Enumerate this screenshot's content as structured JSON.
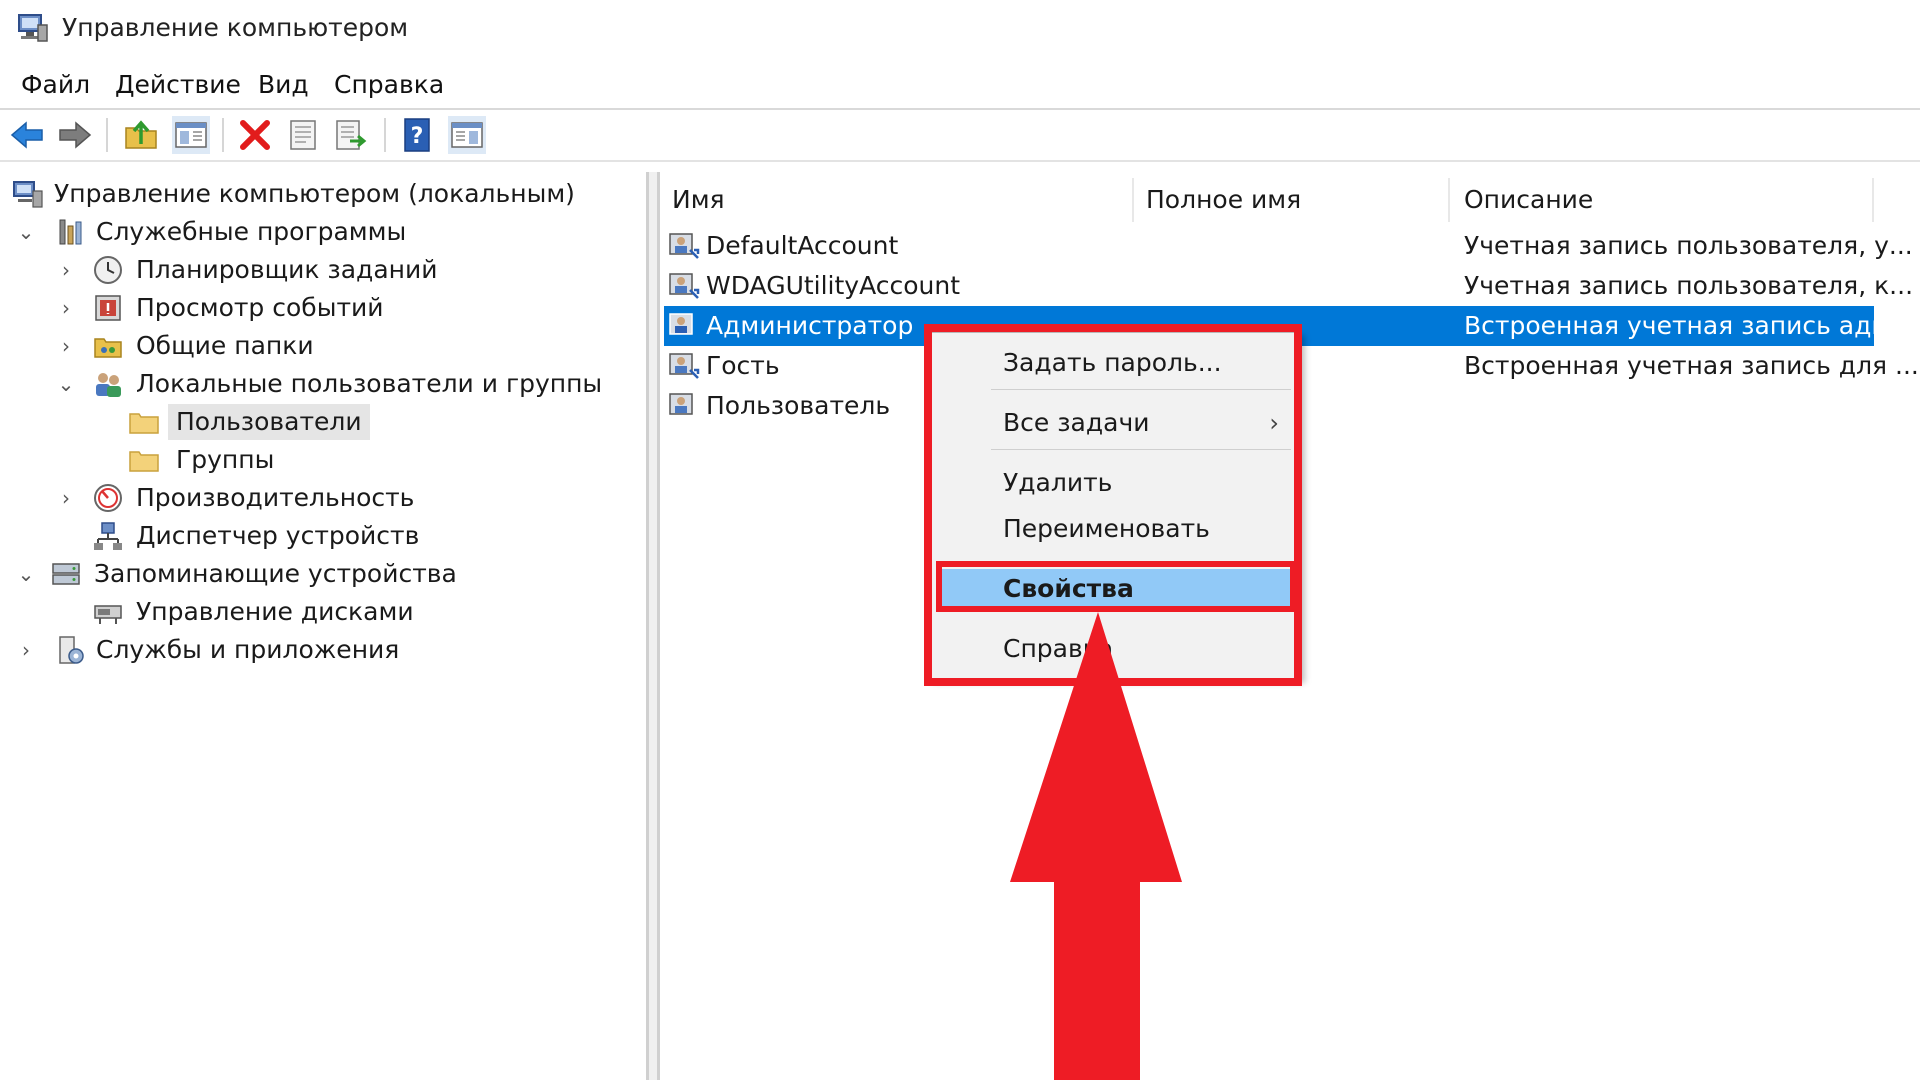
{
  "window": {
    "title": "Управление компьютером",
    "icon": "computer-management-icon"
  },
  "menu": {
    "items": [
      "Файл",
      "Действие",
      "Вид",
      "Справка"
    ]
  },
  "toolbar": {
    "icons": [
      "back-arrow-icon",
      "forward-arrow-icon",
      "up-folder-icon",
      "show-hide-tree-icon",
      "delete-icon",
      "properties-icon",
      "export-list-icon",
      "help-icon",
      "show-hide-action-pane-icon"
    ]
  },
  "tree": {
    "items": [
      {
        "label": "Управление компьютером (локальным)",
        "icon": "computer-management-icon",
        "chevron": ""
      },
      {
        "label": "Служебные программы",
        "icon": "system-tools-icon",
        "chevron": "expanded"
      },
      {
        "label": "Планировщик заданий",
        "icon": "clock-icon",
        "chevron": "collapsed"
      },
      {
        "label": "Просмотр событий",
        "icon": "event-viewer-icon",
        "chevron": "collapsed"
      },
      {
        "label": "Общие папки",
        "icon": "shared-folders-icon",
        "chevron": "collapsed"
      },
      {
        "label": "Локальные пользователи и группы",
        "icon": "users-group-icon",
        "chevron": "expanded"
      },
      {
        "label": "Пользователи",
        "icon": "folder-icon",
        "chevron": "",
        "selected": true
      },
      {
        "label": "Группы",
        "icon": "folder-icon",
        "chevron": ""
      },
      {
        "label": "Производительность",
        "icon": "performance-icon",
        "chevron": "collapsed"
      },
      {
        "label": "Диспетчер устройств",
        "icon": "device-manager-icon",
        "chevron": ""
      },
      {
        "label": "Запоминающие устройства",
        "icon": "storage-icon",
        "chevron": "expanded"
      },
      {
        "label": "Управление дисками",
        "icon": "disk-management-icon",
        "chevron": ""
      },
      {
        "label": "Службы и приложения",
        "icon": "services-icon",
        "chevron": "collapsed"
      }
    ]
  },
  "list": {
    "columns": [
      "Имя",
      "Полное имя",
      "Описание"
    ],
    "rows": [
      {
        "name": "DefaultAccount",
        "full_name": "",
        "description": "Учетная запись пользователя, у...",
        "icon": "user-icon"
      },
      {
        "name": "WDAGUtilityAccount",
        "full_name": "",
        "description": "Учетная запись пользователя, к...",
        "icon": "user-icon"
      },
      {
        "name": "Администратор",
        "full_name": "",
        "description": "Встроенная учетная запись адм...",
        "icon": "user-icon",
        "selected": true
      },
      {
        "name": "Гость",
        "full_name": "",
        "description": "Встроенная учетная запись для ...",
        "icon": "user-icon"
      },
      {
        "name": "Пользователь",
        "full_name": "",
        "description": "",
        "icon": "user-icon"
      }
    ]
  },
  "context_menu": {
    "items": [
      {
        "label": "Задать пароль..."
      },
      {
        "label": "Все задачи",
        "submenu": true,
        "arrow": "›"
      },
      {
        "label": "Удалить"
      },
      {
        "label": "Переименовать"
      },
      {
        "label": "Свойства",
        "highlighted": true
      },
      {
        "label": "Справка"
      }
    ]
  },
  "colors": {
    "selection": "#0078d7",
    "menu_highlight": "#91c9f7",
    "annotation_red": "#ee1c25"
  }
}
